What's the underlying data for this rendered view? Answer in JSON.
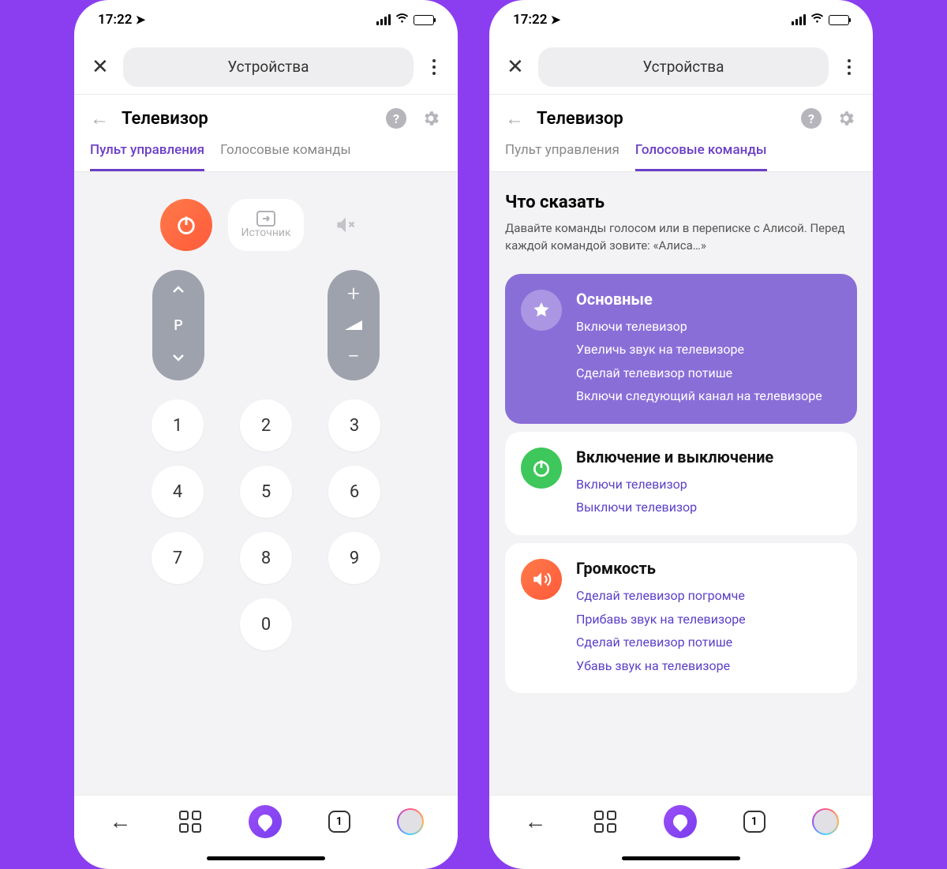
{
  "status": {
    "time": "17:22"
  },
  "topbar": {
    "pill_label": "Устройства"
  },
  "subheader": {
    "title": "Телевизор"
  },
  "tabs": {
    "remote": "Пульт управления",
    "voice": "Голосовые команды"
  },
  "remote": {
    "source_label": "Источник",
    "channel_letter": "P",
    "numbers": [
      "1",
      "2",
      "3",
      "4",
      "5",
      "6",
      "7",
      "8",
      "9",
      "0"
    ]
  },
  "voice": {
    "heading": "Что сказать",
    "description": "Давайте команды голосом или в переписке с Алисой. Перед каждой командой зовите: «Алиса…»",
    "groups": [
      {
        "title": "Основные",
        "commands": [
          "Включи телевизор",
          "Увеличь звук на телевизоре",
          "Сделай телевизор потише",
          "Включи следующий канал на телевизоре"
        ]
      },
      {
        "title": "Включение и выключение",
        "commands": [
          "Включи телевизор",
          "Выключи телевизор"
        ]
      },
      {
        "title": "Громкость",
        "commands": [
          "Сделай телевизор погромче",
          "Прибавь звук на телевизоре",
          "Сделай телевизор потише",
          "Убавь звук на телевизоре"
        ]
      }
    ]
  },
  "bottomnav": {
    "tab_count": "1"
  }
}
